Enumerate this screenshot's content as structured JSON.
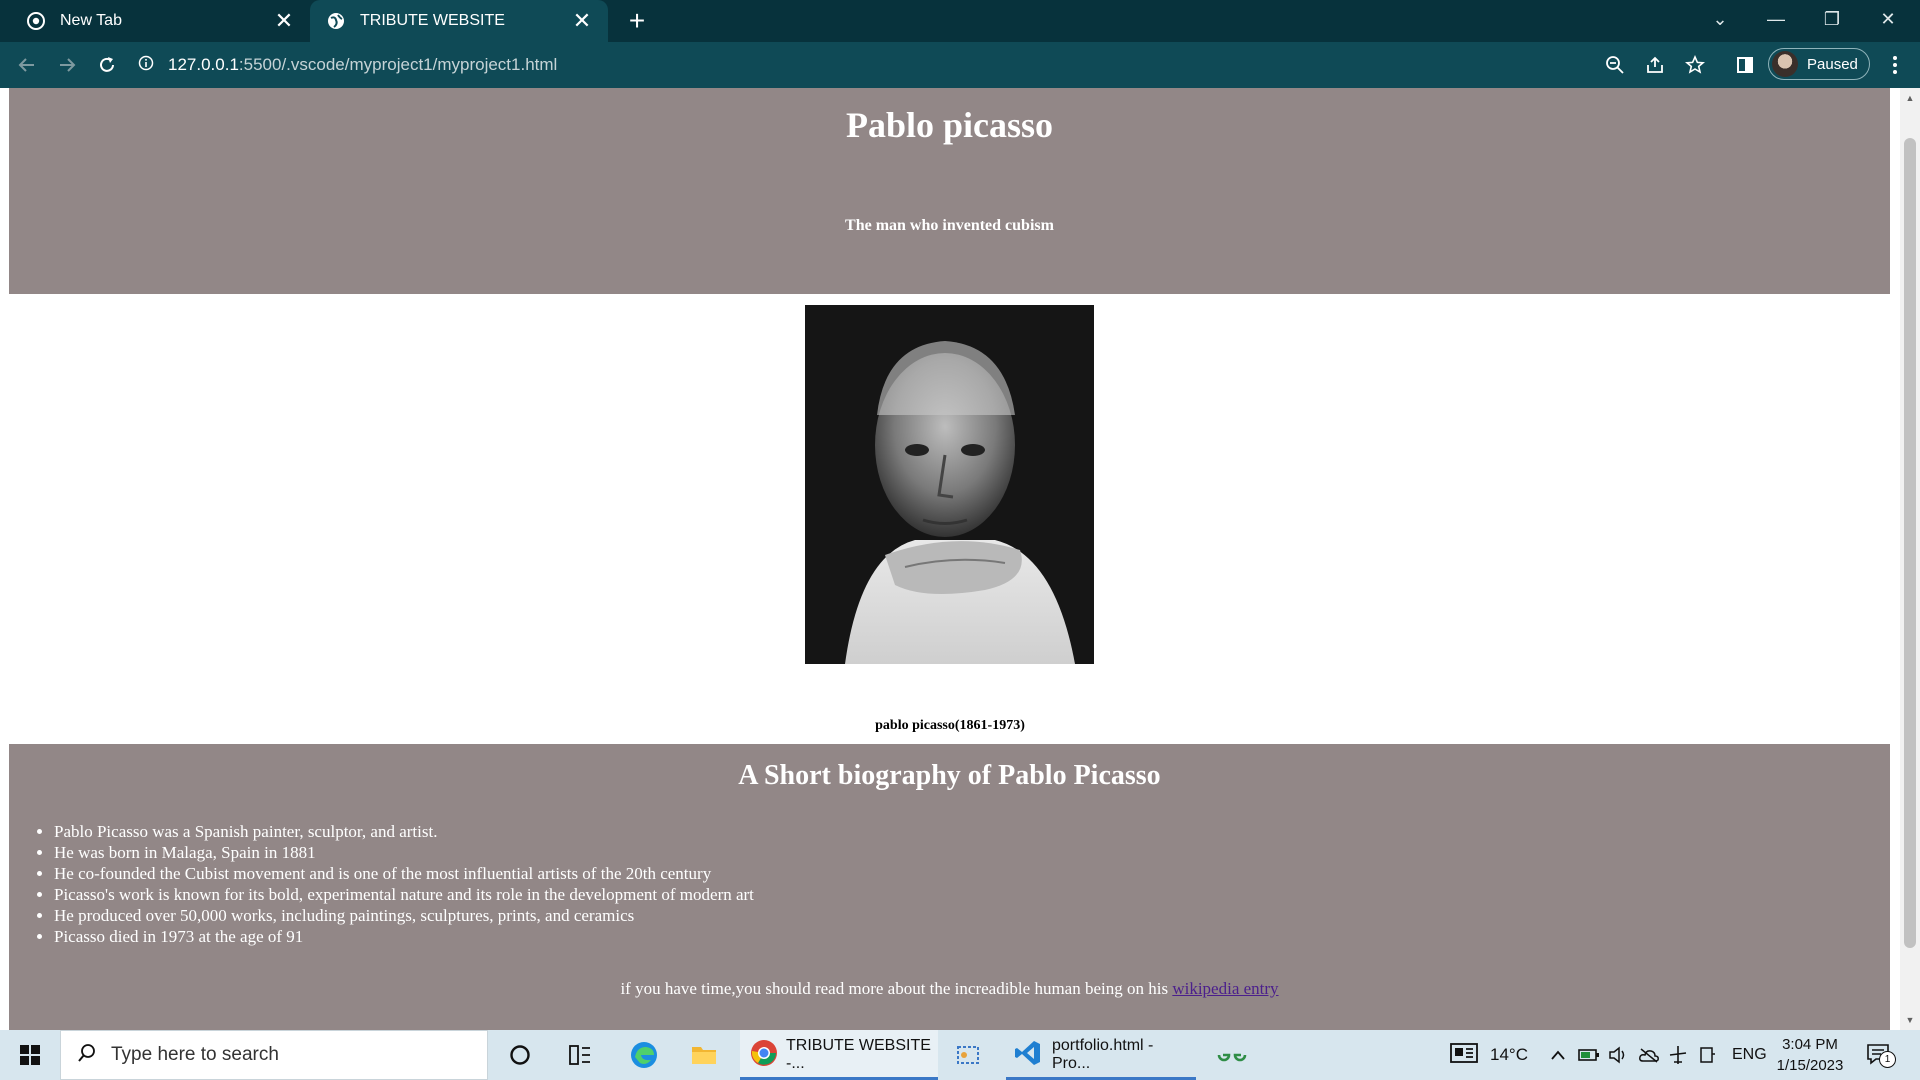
{
  "browser": {
    "tabs": [
      {
        "title": "New Tab",
        "active": false
      },
      {
        "title": "TRIBUTE WEBSITE",
        "active": true
      }
    ],
    "url_host": "127.0.0.1",
    "url_rest": ":5500/.vscode/myproject1/myproject1.html",
    "profile_label": "Paused",
    "colors": {
      "tabbar": "#07323c",
      "toolbar": "#0f4a56"
    }
  },
  "page": {
    "title": "Pablo picasso",
    "subtitle": "The man who invented cubism",
    "image_caption": "pablo picasso(1861-1973)",
    "bio_heading": "A Short biography of Pablo Picasso",
    "bio_items": [
      "Pablo Picasso was a Spanish painter, sculptor, and artist.",
      "He was born in Malaga, Spain in 1881",
      "He co-founded the Cubist movement and is one of the most influential artists of the 20th century",
      "Picasso's work is known for its bold, experimental nature and its role in the development of modern art",
      "He produced over 50,000 works, including paintings, sculptures, prints, and ceramics",
      "Picasso died in 1973 at the age of 91"
    ],
    "more_text": "if you have time,you should read more about the increadible human being on his ",
    "link_text": "wikipedia entry",
    "colors": {
      "section_bg": "#928787",
      "link": "#4b1f8c"
    }
  },
  "taskbar": {
    "search_placeholder": "Type here to search",
    "tasks": [
      {
        "label": "TRIBUTE WEBSITE -...",
        "icon": "chrome-icon"
      },
      {
        "label": "portfolio.html - Pro...",
        "icon": "vscode-icon"
      }
    ],
    "weather": "14°C",
    "language": "ENG",
    "time": "3:04 PM",
    "date": "1/15/2023",
    "notification_count": "1"
  }
}
